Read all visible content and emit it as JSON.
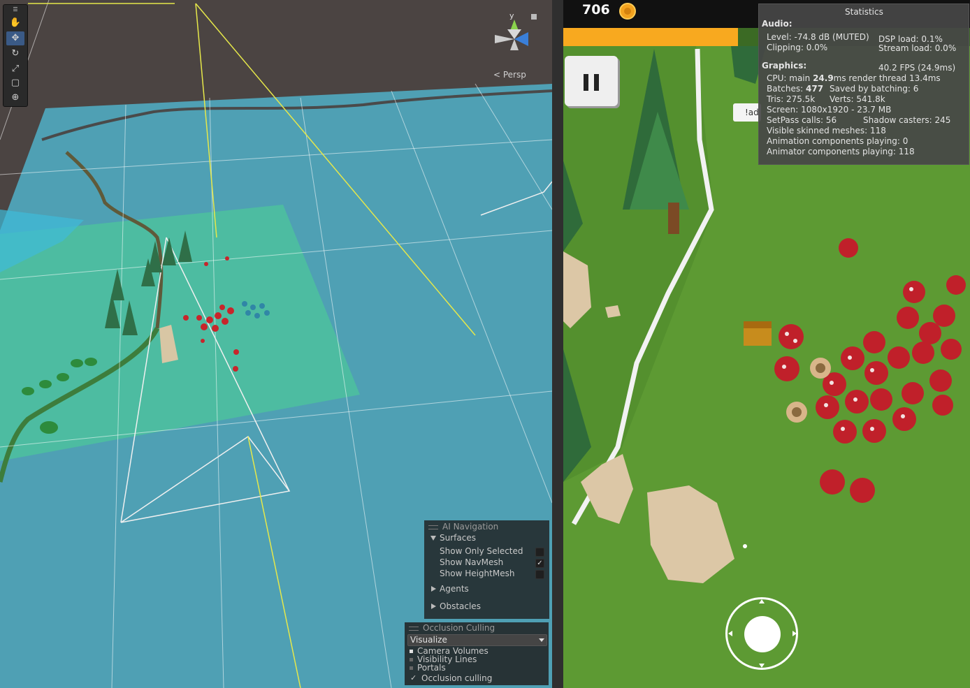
{
  "scene": {
    "tools": [
      "hand-tool",
      "move-tool",
      "rotate-tool",
      "scale-tool",
      "rect-tool",
      "transform-tool"
    ],
    "persp_label": "< Persp",
    "gizmo_axis_label": "y"
  },
  "ai_navigation": {
    "title": "AI Navigation",
    "surfaces_label": "Surfaces",
    "options": [
      {
        "label": "Show Only Selected",
        "checked": false
      },
      {
        "label": "Show NavMesh",
        "checked": true
      },
      {
        "label": "Show HeightMesh",
        "checked": false
      }
    ],
    "agents_label": "Agents",
    "obstacles_label": "Obstacles"
  },
  "occlusion_culling": {
    "title": "Occlusion Culling",
    "mode_value": "Visualize",
    "items": [
      {
        "label": "Camera Volumes"
      },
      {
        "label": "Visibility Lines"
      },
      {
        "label": "Portals"
      }
    ],
    "culling_label": "Occlusion culling",
    "culling_checked": true
  },
  "game": {
    "score": "706",
    "progress_fraction": 0.43,
    "ad_label": "!ad",
    "colors": {
      "coin": "#f3a21e",
      "progress": "#f8a91f",
      "grass": "#5d9a33"
    }
  },
  "statistics": {
    "title": "Statistics",
    "audio_heading": "Audio:",
    "audio_level": "Level: -74.8 dB (MUTED)",
    "audio_clipping": "Clipping: 0.0%",
    "dsp_load": "DSP load: 0.1%",
    "stream_load": "Stream load: 0.0%",
    "graphics_heading": "Graphics:",
    "fps": "40.2 FPS (24.9ms)",
    "cpu_prefix": "CPU: main ",
    "cpu_main": "24.9",
    "cpu_suffix": "ms  render thread 13.4ms",
    "batches_prefix": "Batches: ",
    "batches": "477",
    "saved_batching": "Saved by batching: 6",
    "tris": "Tris: 275.5k",
    "verts": "Verts: 541.8k",
    "screen": "Screen: 1080x1920 - 23.7 MB",
    "setpass": "SetPass calls: 56",
    "shadow_casters": "Shadow casters: 245",
    "skinned_meshes": "Visible skinned meshes: 118",
    "animation_playing": "Animation components playing: 0",
    "animator_playing": "Animator components playing: 118"
  }
}
